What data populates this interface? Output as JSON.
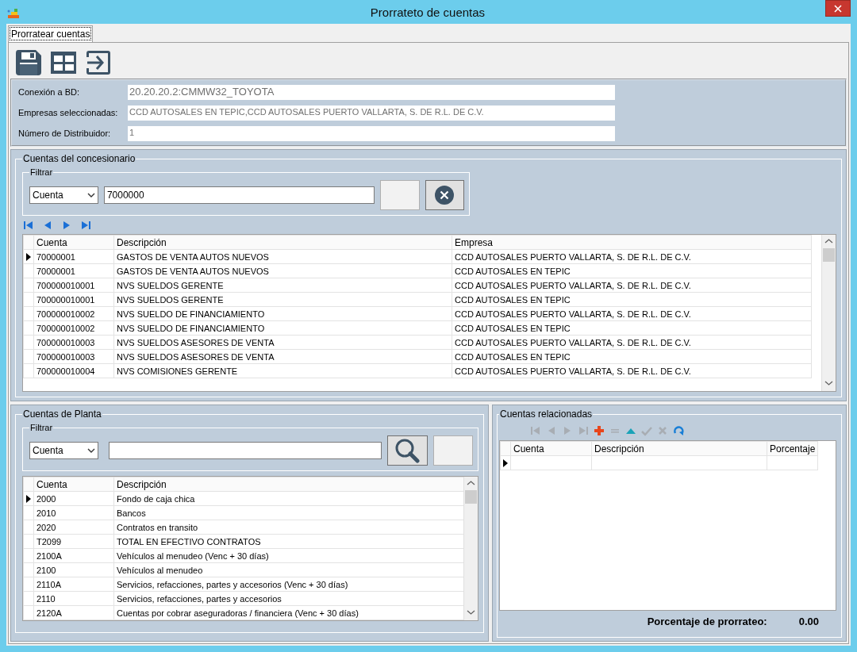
{
  "window": {
    "title": "Prorrateto de cuentas"
  },
  "tabs": [
    {
      "label": "Prorratear cuentas",
      "selected": true
    }
  ],
  "toolbar": [
    {
      "kind": "save"
    },
    {
      "kind": "grid"
    },
    {
      "kind": "exit"
    }
  ],
  "connection": [
    {
      "label": "Conexión a BD:",
      "value": "20.20.20.2:CMMW32_TOYOTA"
    },
    {
      "label": "Empresas seleccionadas:",
      "value": "CCD AUTOSALES EN TEPIC,CCD AUTOSALES PUERTO VALLARTA, S. DE R.L. DE C.V."
    },
    {
      "label": "Número de Distribuidor:",
      "value": "1"
    }
  ],
  "dealer_accounts": {
    "title": "Cuentas del concesionario",
    "filter": {
      "title": "Filtrar",
      "field": "Cuenta",
      "value": "7000000"
    },
    "nav": [
      {
        "kind": "first",
        "disabled": false
      },
      {
        "kind": "prev",
        "disabled": false
      },
      {
        "kind": "next",
        "disabled": false
      },
      {
        "kind": "last",
        "disabled": false
      }
    ],
    "table": {
      "columns": [
        "Cuenta",
        "Descripción",
        "Empresa"
      ],
      "rows": [
        {
          "selected": true,
          "cells": [
            "70000001",
            "GASTOS DE VENTA AUTOS NUEVOS",
            "CCD AUTOSALES PUERTO VALLARTA, S. DE R.L. DE C.V."
          ]
        },
        {
          "selected": false,
          "cells": [
            "70000001",
            "GASTOS DE VENTA AUTOS NUEVOS",
            "CCD AUTOSALES EN TEPIC"
          ]
        },
        {
          "selected": false,
          "cells": [
            "700000010001",
            "NVS SUELDOS GERENTE",
            "CCD AUTOSALES PUERTO VALLARTA, S. DE R.L. DE C.V."
          ]
        },
        {
          "selected": false,
          "cells": [
            "700000010001",
            "NVS SUELDOS GERENTE",
            "CCD AUTOSALES EN TEPIC"
          ]
        },
        {
          "selected": false,
          "cells": [
            "700000010002",
            "NVS SUELDO DE FINANCIAMIENTO",
            "CCD AUTOSALES PUERTO VALLARTA, S. DE R.L. DE C.V."
          ]
        },
        {
          "selected": false,
          "cells": [
            "700000010002",
            "NVS SUELDO DE FINANCIAMIENTO",
            "CCD AUTOSALES EN TEPIC"
          ]
        },
        {
          "selected": false,
          "cells": [
            "700000010003",
            "NVS SUELDOS ASESORES DE VENTA",
            "CCD AUTOSALES PUERTO VALLARTA, S. DE R.L. DE C.V."
          ]
        },
        {
          "selected": false,
          "cells": [
            "700000010003",
            "NVS SUELDOS ASESORES DE VENTA",
            "CCD AUTOSALES EN TEPIC"
          ]
        },
        {
          "selected": false,
          "cells": [
            "700000010004",
            "NVS COMISIONES GERENTE",
            "CCD AUTOSALES PUERTO VALLARTA, S. DE R.L. DE C.V."
          ]
        }
      ]
    }
  },
  "plant_accounts": {
    "title": "Cuentas de Planta",
    "filter": {
      "title": "Filtrar",
      "field": "Cuenta"
    },
    "table": {
      "columns": [
        "Cuenta",
        "Descripción"
      ],
      "rows": [
        {
          "selected": true,
          "cells": [
            "2000",
            "Fondo de caja chica"
          ]
        },
        {
          "selected": false,
          "cells": [
            "2010",
            "Bancos"
          ]
        },
        {
          "selected": false,
          "cells": [
            "2020",
            "Contratos en transito"
          ]
        },
        {
          "selected": false,
          "cells": [
            "T2099",
            "TOTAL EN EFECTIVO CONTRATOS"
          ]
        },
        {
          "selected": false,
          "cells": [
            "2100A",
            "Vehículos al menudeo (Venc + 30 días)"
          ]
        },
        {
          "selected": false,
          "cells": [
            "2100",
            "Vehículos al menudeo"
          ]
        },
        {
          "selected": false,
          "cells": [
            "2110A",
            "Servicios, refacciones, partes y accesorios  (Venc + 30 días)"
          ]
        },
        {
          "selected": false,
          "cells": [
            "2110",
            "Servicios, refacciones, partes y accesorios"
          ]
        },
        {
          "selected": false,
          "cells": [
            "2120A",
            "Cuentas por cobrar aseguradoras / financiera (Venc + 30 días)"
          ]
        }
      ]
    }
  },
  "related_accounts": {
    "title": "Cuentas relacionadas",
    "toolbar": [
      {
        "kind": "first",
        "disabled": true
      },
      {
        "kind": "prev",
        "disabled": true
      },
      {
        "kind": "next",
        "disabled": true
      },
      {
        "kind": "last",
        "disabled": true
      },
      {
        "kind": "add",
        "disabled": false
      },
      {
        "kind": "remove",
        "disabled": true
      },
      {
        "kind": "edit",
        "disabled": false
      },
      {
        "kind": "post",
        "disabled": true
      },
      {
        "kind": "cancel",
        "disabled": true
      },
      {
        "kind": "refresh",
        "disabled": false
      }
    ],
    "table": {
      "columns": [
        "Cuenta",
        "Descripción",
        "Porcentaje"
      ],
      "rows": [
        {
          "selected": true
        }
      ]
    },
    "summary": {
      "label": "Porcentaje de prorrateo:",
      "value": "0.00"
    }
  }
}
